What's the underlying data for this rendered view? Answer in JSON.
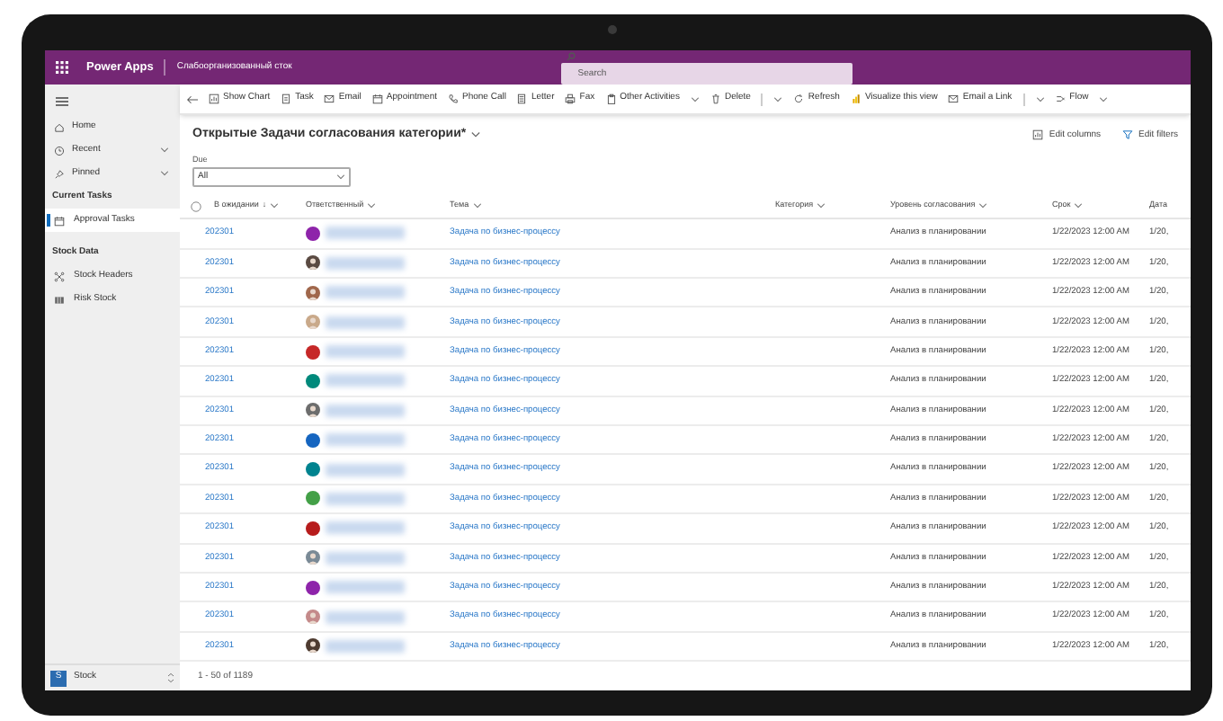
{
  "app_bar": {
    "app_name": "Power Apps",
    "environment": "Слабоорганизованный сток",
    "search": {
      "placeholder": "Search"
    }
  },
  "toolbar": [
    {
      "label": "Show Chart",
      "kind": "plain"
    },
    {
      "label": "Task",
      "kind": "plain"
    },
    {
      "label": "Email",
      "kind": "plain"
    },
    {
      "label": "Appointment",
      "kind": "plain"
    },
    {
      "label": "Phone Call",
      "kind": "plain"
    },
    {
      "label": "Letter",
      "kind": "plain"
    },
    {
      "label": "Fax",
      "kind": "plain"
    },
    {
      "label": "Other Activities",
      "kind": "dropdown"
    },
    {
      "label": "Delete",
      "kind": "split"
    },
    {
      "label": "Refresh",
      "kind": "plain"
    },
    {
      "label": "Visualize this view",
      "kind": "plain"
    },
    {
      "label": "Email a Link",
      "kind": "split"
    },
    {
      "label": "Flow",
      "kind": "dropdown"
    }
  ],
  "sidebar": {
    "items": [
      {
        "label": "Home",
        "kind": "link"
      },
      {
        "label": "Recent",
        "kind": "group"
      },
      {
        "label": "Pinned",
        "kind": "group"
      }
    ],
    "groups": [
      {
        "title": "Current Tasks",
        "items": [
          {
            "label": "Approval Tasks",
            "selected": true
          }
        ]
      },
      {
        "title": "Stock Data",
        "items": [
          {
            "label": "Stock Headers",
            "selected": false
          },
          {
            "label": "Risk Stock",
            "selected": false
          }
        ]
      }
    ],
    "area": {
      "initial": "S",
      "label": "Stock"
    }
  },
  "view": {
    "title": "Открытые Задачи согласования категории*",
    "edit_columns": "Edit columns",
    "edit_filters": "Edit filters",
    "filter": {
      "label": "Due",
      "value": "All"
    }
  },
  "table": {
    "select_all": {
      "checked": false
    },
    "columns": [
      {
        "label": "В ожидании",
        "sort": "↓"
      },
      {
        "label": "Ответственный"
      },
      {
        "label": "Тема"
      },
      {
        "label": "Категория"
      },
      {
        "label": "Уровень согласования"
      },
      {
        "label": "Срок"
      },
      {
        "label": "Дата"
      }
    ],
    "rows": [
      {
        "id": "202301",
        "avatar": {
          "kind": "initials",
          "color": "#8e24aa"
        },
        "subject": "Задача по бизнес-процессу",
        "level": "Анализ в планировании",
        "due": "1/22/2023 12:00 AM",
        "date": "1/20,"
      },
      {
        "id": "202301",
        "avatar": {
          "kind": "photo",
          "color": "#5a4a42"
        },
        "subject": "Задача по бизнес-процессу",
        "level": "Анализ в планировании",
        "due": "1/22/2023 12:00 AM",
        "date": "1/20,"
      },
      {
        "id": "202301",
        "avatar": {
          "kind": "photo",
          "color": "#a0674b"
        },
        "subject": "Задача по бизнес-процессу",
        "level": "Анализ в планировании",
        "due": "1/22/2023 12:00 AM",
        "date": "1/20,"
      },
      {
        "id": "202301",
        "avatar": {
          "kind": "photo",
          "color": "#c9a98a"
        },
        "subject": "Задача по бизнес-процессу",
        "level": "Анализ в планировании",
        "due": "1/22/2023 12:00 AM",
        "date": "1/20,"
      },
      {
        "id": "202301",
        "avatar": {
          "kind": "initials",
          "color": "#c62828"
        },
        "subject": "Задача по бизнес-процессу",
        "level": "Анализ в планировании",
        "due": "1/22/2023 12:00 AM",
        "date": "1/20,"
      },
      {
        "id": "202301",
        "avatar": {
          "kind": "initials",
          "color": "#00897b"
        },
        "subject": "Задача по бизнес-процессу",
        "level": "Анализ в планировании",
        "due": "1/22/2023 12:00 AM",
        "date": "1/20,"
      },
      {
        "id": "202301",
        "avatar": {
          "kind": "photo",
          "color": "#6d6d6d"
        },
        "subject": "Задача по бизнес-процессу",
        "level": "Анализ в планировании",
        "due": "1/22/2023 12:00 AM",
        "date": "1/20,"
      },
      {
        "id": "202301",
        "avatar": {
          "kind": "initials",
          "color": "#1565c0"
        },
        "subject": "Задача по бизнес-процессу",
        "level": "Анализ в планировании",
        "due": "1/22/2023 12:00 AM",
        "date": "1/20,"
      },
      {
        "id": "202301",
        "avatar": {
          "kind": "initials",
          "color": "#00838f"
        },
        "subject": "Задача по бизнес-процессу",
        "level": "Анализ в планировании",
        "due": "1/22/2023 12:00 AM",
        "date": "1/20,"
      },
      {
        "id": "202301",
        "avatar": {
          "kind": "initials",
          "color": "#43a047"
        },
        "subject": "Задача по бизнес-процессу",
        "level": "Анализ в планировании",
        "due": "1/22/2023 12:00 AM",
        "date": "1/20,"
      },
      {
        "id": "202301",
        "avatar": {
          "kind": "initials",
          "color": "#b71c1c"
        },
        "subject": "Задача по бизнес-процессу",
        "level": "Анализ в планировании",
        "due": "1/22/2023 12:00 AM",
        "date": "1/20,"
      },
      {
        "id": "202301",
        "avatar": {
          "kind": "photo",
          "color": "#7a8a96"
        },
        "subject": "Задача по бизнес-процессу",
        "level": "Анализ в планировании",
        "due": "1/22/2023 12:00 AM",
        "date": "1/20,"
      },
      {
        "id": "202301",
        "avatar": {
          "kind": "initials",
          "color": "#8e24aa"
        },
        "subject": "Задача по бизнес-процессу",
        "level": "Анализ в планировании",
        "due": "1/22/2023 12:00 AM",
        "date": "1/20,"
      },
      {
        "id": "202301",
        "avatar": {
          "kind": "photo",
          "color": "#c48a8a"
        },
        "subject": "Задача по бизнес-процессу",
        "level": "Анализ в планировании",
        "due": "1/22/2023 12:00 AM",
        "date": "1/20,"
      },
      {
        "id": "202301",
        "avatar": {
          "kind": "photo",
          "color": "#4e3b30"
        },
        "subject": "Задача по бизнес-процессу",
        "level": "Анализ в планировании",
        "due": "1/22/2023 12:00 AM",
        "date": "1/20,"
      }
    ]
  },
  "footer": {
    "count": "1 - 50 of 1189"
  }
}
